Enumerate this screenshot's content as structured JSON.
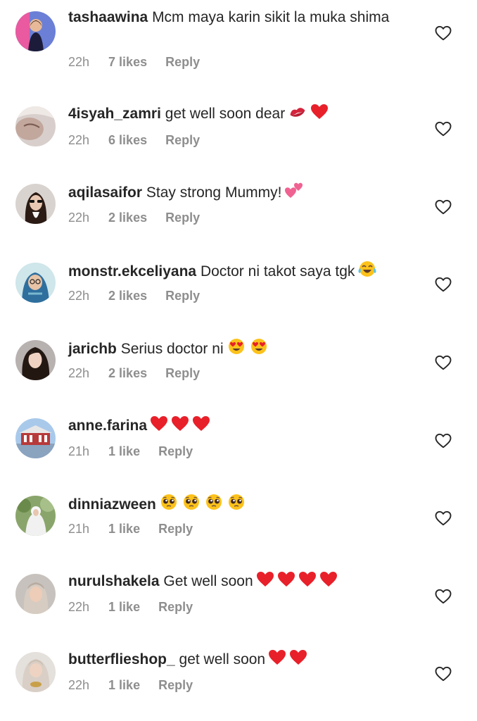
{
  "comments": [
    {
      "username": "tashaawina",
      "text": "Mcm maya karin sikit la muka shima",
      "emojis": [],
      "time": "22h",
      "likes": "7 likes",
      "reply": "Reply"
    },
    {
      "username": "4isyah_zamri",
      "text": "get well soon dear",
      "emojis": [
        "kiss-mark",
        "red-heart"
      ],
      "time": "22h",
      "likes": "6 likes",
      "reply": "Reply"
    },
    {
      "username": "aqilasaifor",
      "text": "Stay strong Mummy!",
      "emojis": [
        "two-hearts"
      ],
      "time": "22h",
      "likes": "2 likes",
      "reply": "Reply"
    },
    {
      "username": "monstr.ekceliyana",
      "text": "Doctor ni takot saya tgk",
      "emojis": [
        "tears-of-joy"
      ],
      "time": "22h",
      "likes": "2 likes",
      "reply": "Reply"
    },
    {
      "username": "jarichb",
      "text": "Serius doctor ni",
      "emojis": [
        "heart-eyes",
        "heart-eyes"
      ],
      "time": "22h",
      "likes": "2 likes",
      "reply": "Reply"
    },
    {
      "username": "anne.farina",
      "text": "",
      "emojis": [
        "red-heart",
        "red-heart",
        "red-heart"
      ],
      "time": "21h",
      "likes": "1 like",
      "reply": "Reply"
    },
    {
      "username": "dinniazween",
      "text": "",
      "emojis": [
        "pleading-face",
        "pleading-face",
        "pleading-face",
        "pleading-face"
      ],
      "time": "21h",
      "likes": "1 like",
      "reply": "Reply"
    },
    {
      "username": "nurulshakela",
      "text": "Get well soon",
      "emojis": [
        "red-heart",
        "red-heart",
        "red-heart",
        "red-heart"
      ],
      "time": "22h",
      "likes": "1 like",
      "reply": "Reply"
    },
    {
      "username": "butterflieshop_",
      "text": "get well soon",
      "emojis": [
        "red-heart",
        "red-heart"
      ],
      "time": "22h",
      "likes": "1 like",
      "reply": "Reply"
    }
  ],
  "colors": {
    "username": "#262626",
    "meta": "#8e8e8e",
    "heart_outline": "#262626",
    "red_heart": "#e8202a",
    "emoji_yellow": "#fcc21b",
    "kiss_red": "#d3243c",
    "two_hearts_pink": "#f06292"
  },
  "icons": {
    "like": "heart-outline-icon"
  }
}
